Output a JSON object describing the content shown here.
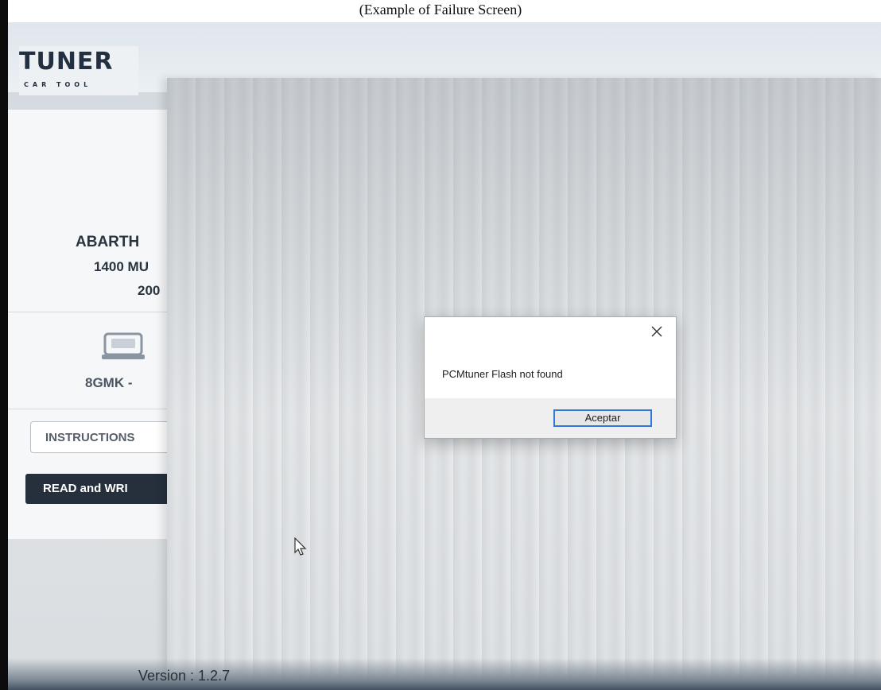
{
  "caption": "(Example of Failure Screen)",
  "app": {
    "logo_main": "TUNER",
    "logo_sub": "CAR TOOL"
  },
  "vehicle": {
    "brand": "ABARTH",
    "model": "1400 MU",
    "year": "200",
    "ecu": "8GMK -"
  },
  "buttons": {
    "instructions": "INSTRUCTIONS",
    "read_write": "READ and WRI"
  },
  "dialog": {
    "message": "PCMtuner Flash not found",
    "ok_label": "Aceptar"
  },
  "footer": {
    "version": "Version : 1.2.7"
  }
}
